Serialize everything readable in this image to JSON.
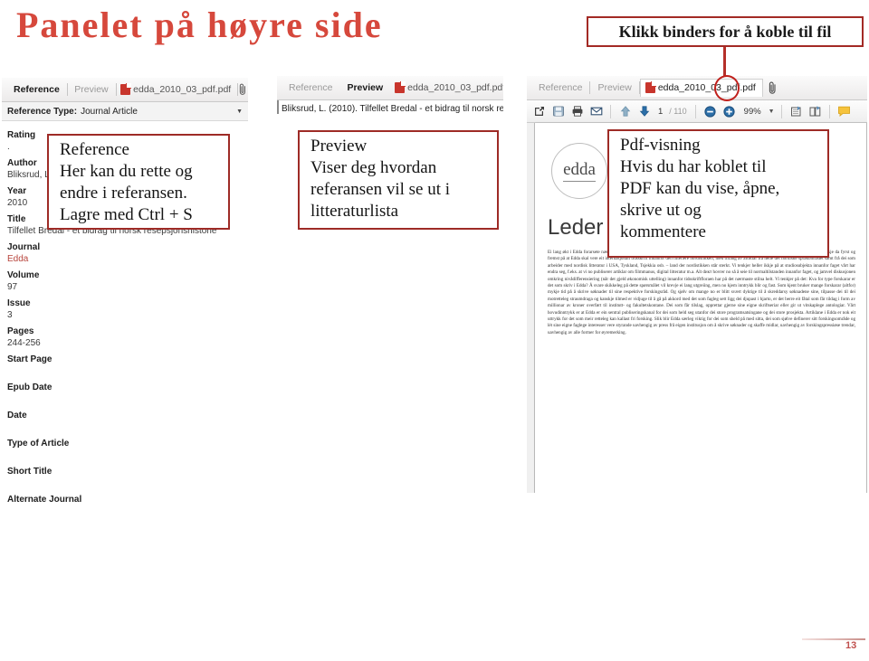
{
  "slide": {
    "title": "Panelet på høyre side",
    "page_number": "13"
  },
  "callout": {
    "text": "Klikk binders for å koble til fil"
  },
  "panels": {
    "reference": {
      "tabs": [
        {
          "label": "Reference",
          "state": "active"
        },
        {
          "label": "Preview",
          "state": "inactive"
        }
      ],
      "file_tab": "edda_2010_03_pdf.pdf",
      "attach_icon": "paperclip-icon",
      "reference_type_label": "Reference Type:",
      "reference_type_value": "Journal Article",
      "fields": [
        {
          "label": "Rating",
          "value": "."
        },
        {
          "label": "Author",
          "value": "Bliksrud, Liv"
        },
        {
          "label": "Year",
          "value": "2010"
        },
        {
          "label": "Title",
          "value": "Tilfellet Bredal - et bidrag til norsk resepsjonshistorie"
        },
        {
          "label": "Journal",
          "value": "Edda",
          "highlight": true
        },
        {
          "label": "Volume",
          "value": "97"
        },
        {
          "label": "Issue",
          "value": "3"
        },
        {
          "label": "Pages",
          "value": "244-256"
        },
        {
          "label": "Start Page",
          "value": ""
        },
        {
          "label": "Epub Date",
          "value": ""
        },
        {
          "label": "Date",
          "value": ""
        },
        {
          "label": "Type of Article",
          "value": ""
        },
        {
          "label": "Short Title",
          "value": ""
        },
        {
          "label": "Alternate Journal",
          "value": ""
        }
      ],
      "annotation": {
        "lines": [
          "Reference",
          "Her kan du rette og",
          "endre i referansen.",
          "Lagre med Ctrl + S"
        ]
      }
    },
    "preview": {
      "tabs": [
        {
          "label": "Reference",
          "state": "inactive"
        },
        {
          "label": "Preview",
          "state": "active"
        }
      ],
      "file_tab": "edda_2010_03_pdf.pdf",
      "attach_icon": "paperclip-icon",
      "citation": "Bliksrud, L. (2010). Tilfellet Bredal - et bidrag til norsk re",
      "annotation": {
        "lines": [
          "Preview",
          "Viser deg hvordan",
          "referansen vil se ut i",
          "litteraturlista"
        ]
      }
    },
    "pdf": {
      "tabs": [
        {
          "label": "Reference",
          "state": "inactive"
        },
        {
          "label": "Preview",
          "state": "inactive"
        }
      ],
      "file_tab": "edda_2010_03_pdf.pdf",
      "attach_icon": "paperclip-icon",
      "toolbar": {
        "open_external": "open-external-icon",
        "save": "save-icon",
        "print": "print-icon",
        "email": "email-icon",
        "prev_page": "arrow-up-icon",
        "next_page": "arrow-down-icon",
        "page_current": "1",
        "page_total": "/ 110",
        "zoom_out": "zoom-out-icon",
        "zoom_in": "zoom-in-icon",
        "zoom_value": "99%",
        "zoom_caret": "chevron-down-icon",
        "layout_single": "page-layout-icon",
        "layout_double": "page-layout-continuous-icon",
        "comment": "sticky-note-icon"
      },
      "document": {
        "logo_text": "edda",
        "heading": "Leder",
        "body": "Ei lang økt i Edda forarsete nærmar seg slutten, og det kan vere grunn til å reflektere over kva for publiseringskanal Edda eigentleg er. Vi tenkjer ikkje da fyrst og fremst på at Edda skal vere eit internasjonalt tidsskrift innanfor den litterære nordistikken, med tilfang av artiklar frå heile det nordiske språkområdet samt frå dei som arbeider med nordisk litteratur i USA, Tyskland, Tsjekkia osb. – land der nordistikken står sterkt. Vi tenkjer heller ikkje på at studiosubjekta innanfor faget vårt har endra seg, f.eks. at vi no publiserer artiklar om filmmanus, digital litteratur m.a. Alt dикт hovrer no så å seie til normaltilstanden innanfor faget, og jamvel diskusjonen omkring nivådifferensiering (når det gjeld økonomisk uttelling) innanfor tidsskriftfloraen har på det nærmaste stilna helt. Vi tenkjer på det: Kva for type forskarar er det som skriv i Edda? Å svare skikkeleg på dette spørsmålet vil krevje ei lang utgreiing, men no kjem inntrykk blir og fast. Som kjent bruker mange forskarar (altfor) mykje tid på å skrive søknader til sine respektive forskingsråd. Og sjølv om mange no er blitt svært dyktige til å skreddarsy søknadene sine, tilpasse dei til dei motretteleg straumdraga og kanskje tilmed er vidjuge til å gå på akkord med det som fagleg sett ligg dei djupast i hjarto, er det berre eit fåtal som får tildag i form av millionar av kroner overført til institutt- og fakultetskontane. Dei som får tilslag, opprettar gjerne sine eigne skriftseriar eller gir ut vitskaplege antologiar. Vårt hovudinntrykk er at Edda er ein sentral publiseringskanal for dei som held seg utanfor dei store programsatsingane og dei store prosjekta. Artiklane i Edda er nok eit uttrykk for det som meir retteleg kan kallast fri forsking. Slik blir Edda særleg viktig for dei som sheld på med sitta, dei som sjølve definerer sitt forskingsområde og lét sine eigne faglege interesser vere styrande uavhengig av press frå eigen institusjon om å skrive søknader og skaffe midlar, uavhengig av forskingspressiøse trendar, uavhengig av alle former for øyremerking."
      },
      "annotation": {
        "lines": [
          "Pdf-visning",
          "Hvis du har koblet til",
          "PDF kan du vise, åpne,",
          "skrive ut og",
          "kommentere"
        ]
      }
    }
  },
  "colors": {
    "title_red": "#D6483C",
    "annotation_border": "#9E2B26",
    "highlight_ellipse": "#C0201C",
    "page_number": "#C0504D"
  }
}
